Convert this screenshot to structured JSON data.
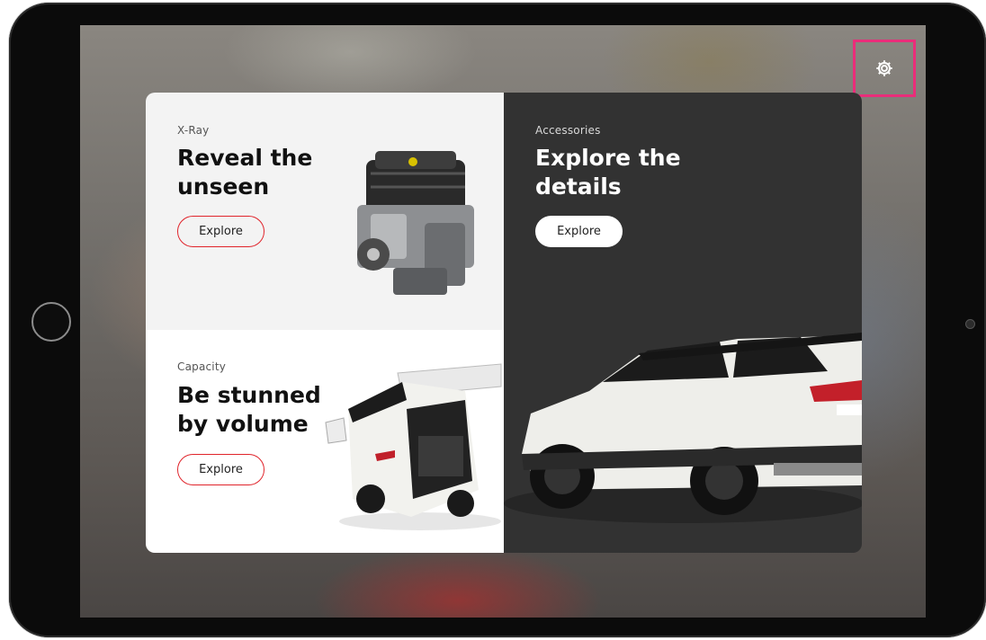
{
  "settings": {
    "icon": "gear-icon",
    "highlight_color": "#ea2d7a"
  },
  "cards": {
    "xray": {
      "label": "X-Ray",
      "title_line1": "Reveal the",
      "title_line2": "unseen",
      "button": "Explore"
    },
    "capacity": {
      "label": "Capacity",
      "title_line1": "Be stunned",
      "title_line2": "by volume",
      "button": "Explore"
    },
    "accessories": {
      "label": "Accessories",
      "title_line1": "Explore the",
      "title_line2": "details",
      "button": "Explore"
    }
  },
  "accent_color": "#e0242b"
}
